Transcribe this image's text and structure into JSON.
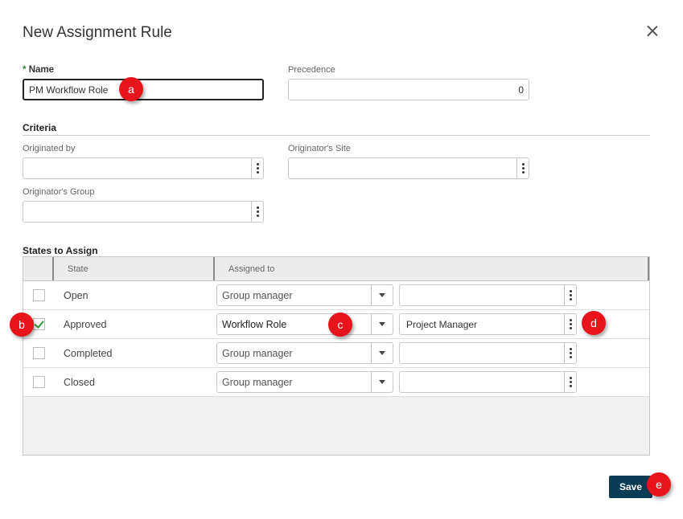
{
  "dialog": {
    "title": "New Assignment Rule"
  },
  "form": {
    "name_required_mark": "*",
    "name_label": "Name",
    "name_value": "PM Workflow Role",
    "precedence_label": "Precedence",
    "precedence_value": "0"
  },
  "criteria": {
    "heading": "Criteria",
    "originated_by_label": "Originated by",
    "originated_by_value": "",
    "originators_site_label": "Originator's Site",
    "originators_site_value": "",
    "originators_group_label": "Originator's Group",
    "originators_group_value": ""
  },
  "states": {
    "heading": "States to Assign",
    "columns": [
      "State",
      "Assigned to"
    ],
    "rows": [
      {
        "state": "Open",
        "checked": false,
        "assigned_type": "Group manager",
        "assigned_value": ""
      },
      {
        "state": "Approved",
        "checked": true,
        "assigned_type": "Workflow Role",
        "assigned_value": "Project Manager"
      },
      {
        "state": "Completed",
        "checked": false,
        "assigned_type": "Group manager",
        "assigned_value": ""
      },
      {
        "state": "Closed",
        "checked": false,
        "assigned_type": "Group manager",
        "assigned_value": ""
      }
    ]
  },
  "annotations": [
    "a",
    "b",
    "c",
    "d",
    "e"
  ],
  "footer": {
    "save_label": "Save"
  },
  "colors": {
    "accent": "#0b3c55",
    "badge": "#e8141b",
    "check": "#2e9b3d",
    "required": "#2e7d32"
  }
}
